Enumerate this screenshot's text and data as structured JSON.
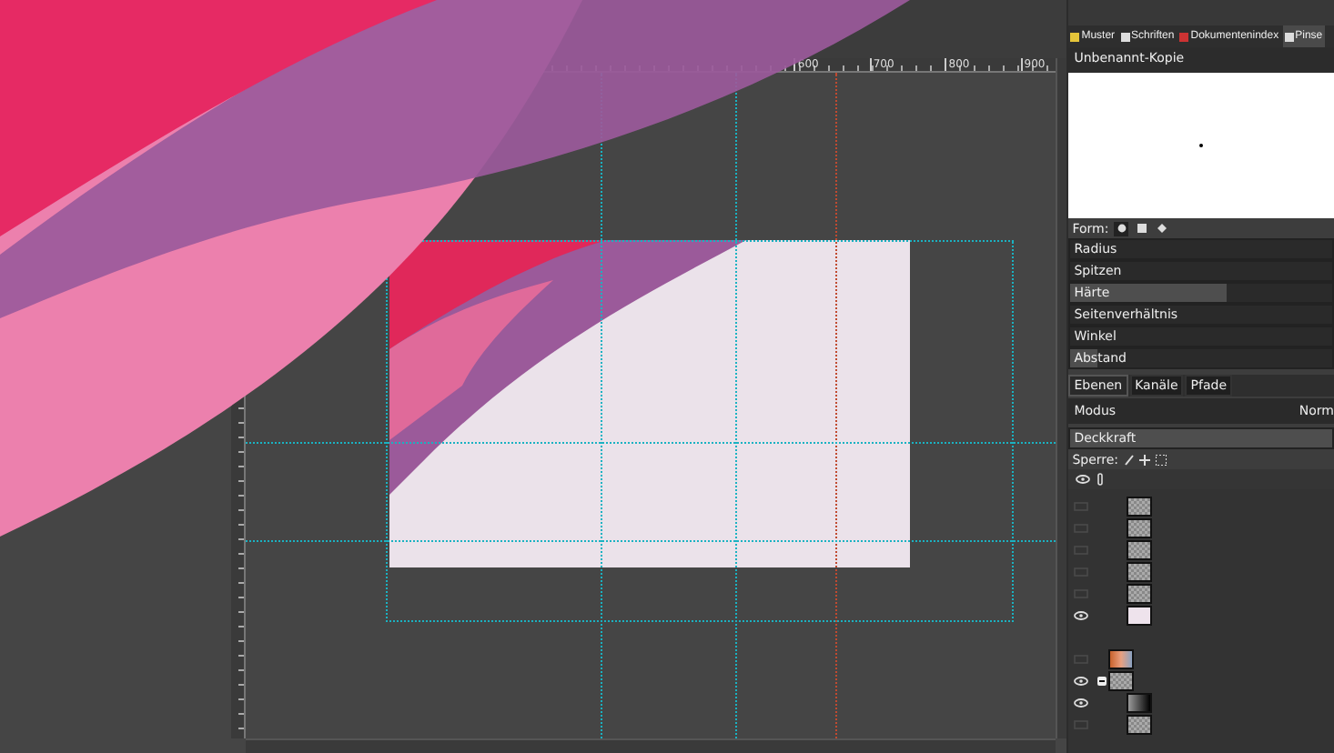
{
  "ruler": {
    "labels": [
      "600",
      "700",
      "800",
      "900"
    ]
  },
  "dock_tabs": [
    {
      "label": "Muster",
      "selected": false
    },
    {
      "label": "Schriften",
      "selected": false
    },
    {
      "label": "Dokumentenindex",
      "selected": false
    },
    {
      "label": "Pinse",
      "selected": true
    }
  ],
  "brush": {
    "name": "Unbenannt-Kopie",
    "form_label": "Form:",
    "shapes": [
      {
        "kind": "circle",
        "selected": true
      },
      {
        "kind": "square",
        "selected": false
      },
      {
        "kind": "diamond",
        "selected": false
      }
    ],
    "sliders": [
      {
        "label": "Radius",
        "level": 0
      },
      {
        "label": "Spitzen",
        "level": 0
      },
      {
        "label": "Härte",
        "level": 0.6
      },
      {
        "label": "Seitenverhältnis",
        "level": 0
      },
      {
        "label": "Winkel",
        "level": 0
      },
      {
        "label": "Abstand",
        "level": 0.1
      }
    ]
  },
  "layer_tabs": [
    {
      "label": "Ebenen",
      "selected": true
    },
    {
      "label": "Kanäle",
      "selected": false
    },
    {
      "label": "Pfade",
      "selected": false
    }
  ],
  "mode": {
    "label": "Modus",
    "value": "Norm"
  },
  "opacity": {
    "label": "Deckkraft",
    "level": 1
  },
  "lock": {
    "label": "Sperre:"
  },
  "layers": [
    {
      "kind": "offscreen-group",
      "children": [
        {
          "visible": false,
          "kind": "checker"
        },
        {
          "visible": false,
          "kind": "checker"
        },
        {
          "visible": false,
          "kind": "checker"
        },
        {
          "visible": false,
          "kind": "checker"
        },
        {
          "visible": false,
          "kind": "checker"
        },
        {
          "visible": true,
          "kind": "pale"
        }
      ]
    },
    {
      "visible": false,
      "kind": "photo"
    },
    {
      "visible": true,
      "kind": "checker",
      "expanded": true,
      "children": [
        {
          "visible": true,
          "kind": "gradient"
        },
        {
          "visible": false,
          "kind": "checker"
        }
      ]
    }
  ]
}
